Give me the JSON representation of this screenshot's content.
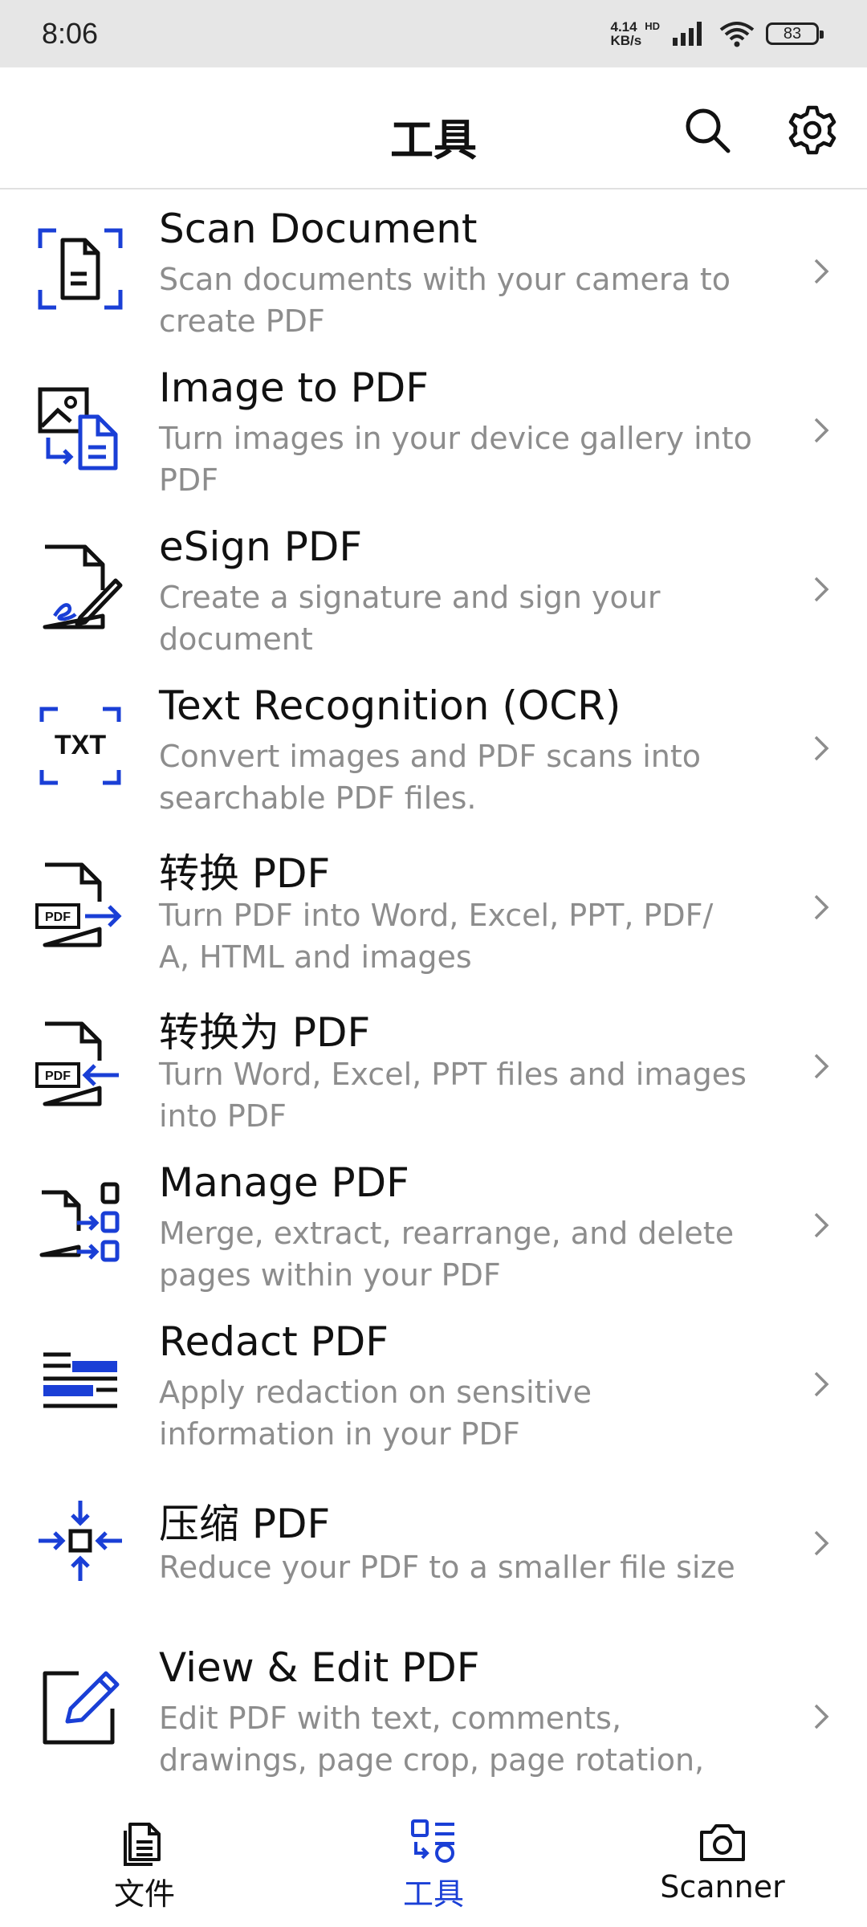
{
  "status_bar": {
    "time": "8:06",
    "net_speed_value": "4.14",
    "net_speed_unit": "KB/s",
    "hd": "HD",
    "battery": "83"
  },
  "app_bar": {
    "title": "工具"
  },
  "tools": [
    {
      "title": "Scan Document",
      "desc": "Scan documents with your camera to create PDF",
      "icon": "scan-document-icon"
    },
    {
      "title": "Image to PDF",
      "desc": "Turn images in your device gallery into PDF",
      "icon": "image-to-pdf-icon"
    },
    {
      "title": "eSign PDF",
      "desc": "Create a signature and sign your document",
      "icon": "esign-icon"
    },
    {
      "title": "Text Recognition (OCR)",
      "desc": "Convert images and PDF scans into searchable PDF files.",
      "icon": "ocr-txt-icon"
    },
    {
      "title": "转换 PDF",
      "desc": "Turn PDF into Word, Excel, PPT, PDF/ A, HTML and images",
      "icon": "convert-from-pdf-icon"
    },
    {
      "title": "转换为 PDF",
      "desc": "Turn Word, Excel, PPT files and images into PDF",
      "icon": "convert-to-pdf-icon"
    },
    {
      "title": "Manage PDF",
      "desc": "Merge, extract, rearrange, and delete pages within your PDF",
      "icon": "manage-pages-icon"
    },
    {
      "title": "Redact PDF",
      "desc": "Apply redaction on sensitive information in your PDF",
      "icon": "redact-icon"
    },
    {
      "title": "压缩 PDF",
      "desc": "Reduce your PDF to a smaller file size",
      "icon": "compress-icon"
    },
    {
      "title": "View & Edit PDF",
      "desc": "Edit PDF with text, comments, drawings, page crop, page rotation,",
      "icon": "edit-pencil-icon"
    }
  ],
  "bottom_nav": {
    "files_label": "文件",
    "tools_label": "工具",
    "scanner_label": "Scanner",
    "active_tab": "tools"
  },
  "colors": {
    "accent": "#1a3fd6",
    "text_primary": "#111111",
    "text_secondary": "#8d8d8d",
    "status_bar_bg": "#e6e6e6"
  }
}
